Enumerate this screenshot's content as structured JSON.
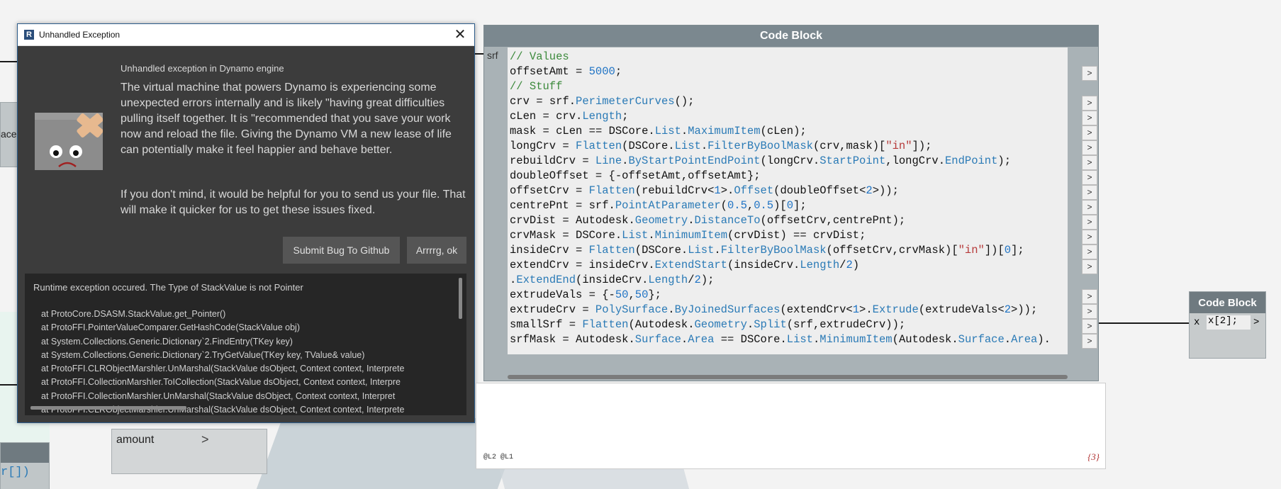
{
  "dialog": {
    "title": "Unhandled Exception",
    "heading": "Unhandled exception in Dynamo engine",
    "paragraph1": "The virtual machine that powers Dynamo is experiencing some unexpected errors internally and is likely \"having great difficulties pulling itself together. It is \"recommended that you save your work now and reload the file. Giving the Dynamo VM a new lease of life can potentially make it feel happier and behave better.",
    "paragraph2": "If you don't mind, it would be helpful for you to send us your file. That will make it quicker for us to get these issues fixed.",
    "submit_button": "Submit Bug To Github",
    "ok_button": "Arrrrg, ok",
    "trace_summary": "Runtime exception occured. The Type of StackValue is not Pointer",
    "trace_lines": [
      "at ProtoCore.DSASM.StackValue.get_Pointer()",
      "at ProtoFFI.PointerValueComparer.GetHashCode(StackValue obj)",
      "at System.Collections.Generic.Dictionary`2.FindEntry(TKey key)",
      "at System.Collections.Generic.Dictionary`2.TryGetValue(TKey key, TValue& value)",
      "at ProtoFFI.CLRObjectMarshler.UnMarshal(StackValue dsObject, Context context, Interprete",
      "at ProtoFFI.CollectionMarshler.ToICollection(StackValue dsObject, Context context, Interpre",
      "at ProtoFFI.CollectionMarshler.UnMarshal(StackValue dsObject, Context context, Interpret",
      "at ProtoFFI.CLRObjectMarshler.UnMarshal(StackValue dsObject, Context context, Interprete"
    ]
  },
  "code_block": {
    "title": "Code Block",
    "input_port": "srf",
    "lines": [
      "// Values",
      "offsetAmt = 5000;",
      "// Stuff",
      "crv = srf.PerimeterCurves();",
      "cLen = crv.Length;",
      "mask = cLen == DSCore.List.MaximumItem(cLen);",
      "longCrv = Flatten(DSCore.List.FilterByBoolMask(crv,mask)[\"in\"]);",
      "rebuildCrv = Line.ByStartPointEndPoint(longCrv.StartPoint,longCrv.EndPoint);",
      "doubleOffset = {-offsetAmt,offsetAmt};",
      "offsetCrv = Flatten(rebuildCrv<1>.Offset(doubleOffset<2>));",
      "centrePnt = srf.PointAtParameter(0.5,0.5)[0];",
      "crvDist = Autodesk.Geometry.DistanceTo(offsetCrv,centrePnt);",
      "crvMask = DSCore.List.MinimumItem(crvDist) == crvDist;",
      "insideCrv = Flatten(DSCore.List.FilterByBoolMask(offsetCrv,crvMask)[\"in\"])[0];",
      "extendCrv = insideCrv.ExtendStart(insideCrv.Length/2)",
      ".ExtendEnd(insideCrv.Length/2);",
      "extrudeVals = {-50,50};",
      "extrudeCrv = PolySurface.ByJoinedSurfaces(extendCrv<1>.Extrude(extrudeVals<2>));",
      "smallSrf = Flatten(Autodesk.Geometry.Split(srf,extrudeCrv));",
      "srfMask = Autodesk.Surface.Area == DSCore.List.MinimumItem(Autodesk.Surface.Area)."
    ],
    "output_arrow": ">"
  },
  "preview": {
    "levels": "@L2 @L1",
    "count": "{3}"
  },
  "small_code_block": {
    "title": "Code Block",
    "port": "x",
    "code": "x[2];",
    "arrow": ">"
  },
  "left_nodes": {
    "amount_label": "amount",
    "amount_chevron": ">",
    "partial_text_1": "ace",
    "partial_text_2": "r[])"
  },
  "colors": {
    "dialog_bg": "#3c3c3c",
    "node_title": "#7b888f",
    "comment": "#3c8a3c",
    "function": "#2a7ab6",
    "number": "#1f73c4",
    "string": "#b63a3a"
  }
}
